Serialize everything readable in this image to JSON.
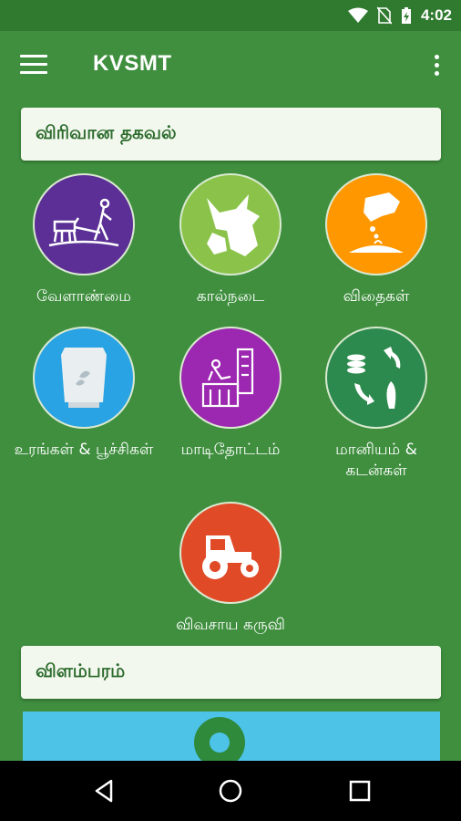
{
  "status": {
    "time": "4:02"
  },
  "app": {
    "title": "KVSMT"
  },
  "sections": {
    "info_title": "விரிவான தகவல்",
    "ads_title": "விளம்பரம்"
  },
  "categories": [
    {
      "label": "வேளாண்மை",
      "color": "#5b2f95",
      "icon": "plough-icon"
    },
    {
      "label": "கால்நடை",
      "color": "#8bc34a",
      "icon": "cattle-icon"
    },
    {
      "label": "விதைகள்",
      "color": "#ff9800",
      "icon": "seeds-icon"
    },
    {
      "label": "உரங்கள் & பூச்சிகள்",
      "color": "#29a3e3",
      "icon": "fertilizer-bag-icon"
    },
    {
      "label": "மாடிதோட்டம்",
      "color": "#9c27b0",
      "icon": "terrace-garden-icon"
    },
    {
      "label": "மானியம் & கடன்கள்",
      "color": "#2d8a4e",
      "icon": "subsidy-cycle-icon"
    },
    {
      "label": "விவசாய கருவி",
      "color": "#e04a27",
      "icon": "tractor-icon"
    }
  ],
  "colors": {
    "background": "#3f8f3f",
    "status_bar": "#2f7a2f",
    "card": "#f3f8ee",
    "card_text": "#2c6b2c",
    "banner": "#4dc3e8"
  }
}
